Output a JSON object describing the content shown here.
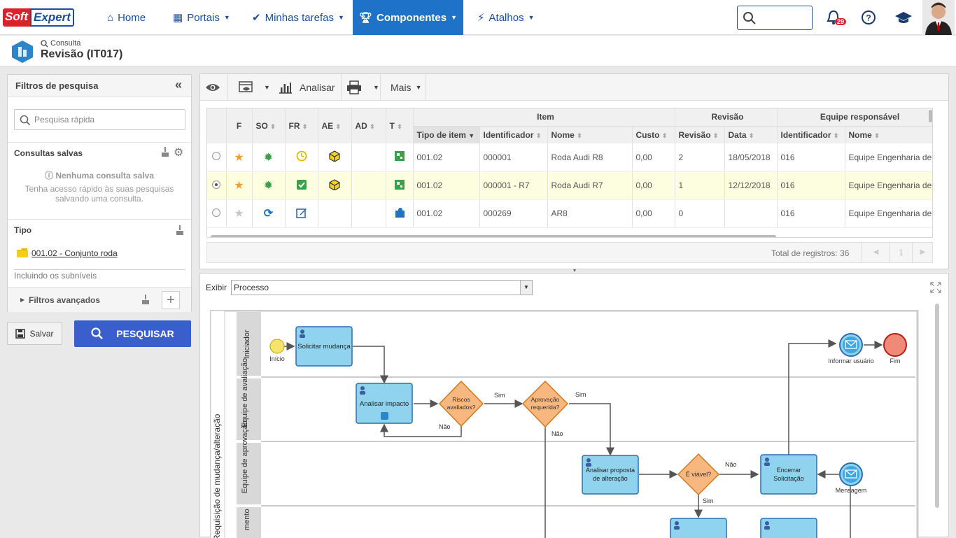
{
  "nav": {
    "logo_soft": "Soft",
    "logo_expert": "Expert",
    "home": "Home",
    "portais": "Portais",
    "tarefas": "Minhas tarefas",
    "componentes": "Componentes",
    "atalhos": "Atalhos",
    "notifications_count": "29"
  },
  "page": {
    "subtitle": "Consulta",
    "title": "Revisão (IT017)"
  },
  "left": {
    "title": "Filtros de pesquisa",
    "quick_search_placeholder": "Pesquisa rápida",
    "saved_title": "Consultas salvas",
    "saved_none": "Nenhuma consulta salva",
    "saved_hint_1": "Tenha acesso rápido às suas pesquisas",
    "saved_hint_2": "salvando uma consulta.",
    "tipo_title": "Tipo",
    "tipo_value": "001.02 - Conjunto roda",
    "tipo_sub": "Incluindo os subníveis",
    "advanced": "Filtros avançados",
    "save_btn": "Salvar",
    "search_btn": "PESQUISAR"
  },
  "toolbar": {
    "analisar": "Analisar",
    "mais": "Mais"
  },
  "grid": {
    "group_headers": [
      "Item",
      "Revisão",
      "Equipe responsável"
    ],
    "icon_headers": [
      "F",
      "SO",
      "FR",
      "AE",
      "AD",
      "T"
    ],
    "columns": [
      "Tipo de item",
      "Identificador",
      "Nome",
      "Custo",
      "Revisão",
      "Data",
      "Identificador",
      "Nome"
    ],
    "rows": [
      {
        "selected": false,
        "fav": true,
        "tipo": "001.02",
        "ident": "000001",
        "nome": "Roda Audi R8",
        "custo": "0,00",
        "rev": "2",
        "data": "18/05/2018",
        "eq_id": "016",
        "eq_nome": "Equipe Engenharia de"
      },
      {
        "selected": true,
        "fav": true,
        "tipo": "001.02",
        "ident": "000001 - R7",
        "nome": "Roda Audi R7",
        "custo": "0,00",
        "rev": "1",
        "data": "12/12/2018",
        "eq_id": "016",
        "eq_nome": "Equipe Engenharia de"
      },
      {
        "selected": false,
        "fav": false,
        "tipo": "001.02",
        "ident": "000269",
        "nome": "AR8",
        "custo": "0,00",
        "rev": "0",
        "data": "",
        "eq_id": "016",
        "eq_nome": "Equipe Engenharia de"
      }
    ],
    "total": "Total de registros: 36",
    "page": "1"
  },
  "process": {
    "exibir_label": "Exibir",
    "exibir_value": "Processo",
    "pool": "Requisição de mudança/alteração",
    "lanes": [
      "Iniciador",
      "Equipe de avaliação",
      "Equipe de aprovação",
      "mento"
    ],
    "nodes": {
      "inicio": "Início",
      "solicitar": "Solicitar mudança",
      "analisar_impacto": "Analisar impacto",
      "riscos": "Riscos avaliados?",
      "aprovacao": "Aprovação requerida?",
      "analisar_proposta": "Analisar proposta de alteração",
      "viavel": "É viável?",
      "encerrar": "Encerrar Solicitação",
      "informar": "Informar usuário",
      "fim": "Fim",
      "mensagem": "Mensagem"
    },
    "labels": {
      "sim": "Sim",
      "nao": "Não"
    }
  },
  "colors": {
    "brand_blue": "#1e73c8",
    "task_fill": "#8fd3ee",
    "gateway_fill": "#f7b77e",
    "event_start": "#f5e36a",
    "event_end": "#f08a78"
  }
}
